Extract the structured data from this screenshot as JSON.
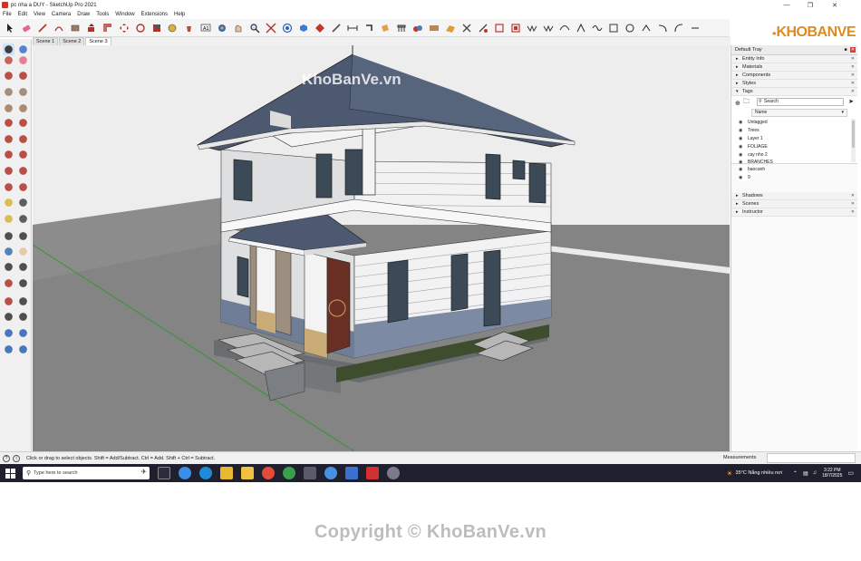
{
  "window": {
    "title": "pc nha a DUY - SketchUp Pro 2021",
    "controls": [
      "minimize-icon",
      "maximize-icon",
      "close-icon"
    ]
  },
  "menu": [
    "File",
    "Edit",
    "View",
    "Camera",
    "Draw",
    "Tools",
    "Window",
    "Extensions",
    "Help"
  ],
  "scenes": [
    "Scene 1",
    "Scene 2",
    "Scene 3"
  ],
  "active_scene": "Scene 3",
  "logo_text": "KHOBANVE",
  "viewport_watermark": "KhoBanVe.vn",
  "tray": {
    "title": "Default Tray",
    "panels_top": [
      {
        "label": "Entity Info",
        "expanded": false
      },
      {
        "label": "Materials",
        "expanded": false
      },
      {
        "label": "Components",
        "expanded": false
      },
      {
        "label": "Styles",
        "expanded": false
      },
      {
        "label": "Tags",
        "expanded": true
      }
    ],
    "tags": {
      "search_placeholder": "Search",
      "column_header": "Name",
      "items": [
        "Untagged",
        "Trees",
        "Layer 1",
        "FOLIAGE",
        "cay nho 2",
        "BRANCHES",
        "baocanh",
        "9"
      ]
    },
    "panels_bottom": [
      {
        "label": "Shadows",
        "expanded": false
      },
      {
        "label": "Scenes",
        "expanded": false
      },
      {
        "label": "Instructor",
        "expanded": false
      }
    ]
  },
  "status": {
    "hint": "Click or drag to select objects. Shift = Add/Subtract. Ctrl = Add. Shift + Ctrl = Subtract.",
    "measurements_label": "Measurements",
    "measurements_value": ""
  },
  "taskbar": {
    "search_placeholder": "Type here to search",
    "weather": "35°C  Nắng nhiều nơi",
    "time": "3:22 PM",
    "date": "18/7/2025"
  },
  "watermark": "Copyright © KhoBanVe.vn",
  "colors": {
    "sky": "#ebebeb",
    "ground": "#848484",
    "roof": "#4c5970",
    "wall": "#f3f3f3",
    "wall_base": "#7d8aa3",
    "stone": "#b39f7f",
    "door": "#6a2f24",
    "green_axis": "#2f9a2f",
    "taskbar": "#1f1f2e",
    "accent": "#e08a1e"
  }
}
